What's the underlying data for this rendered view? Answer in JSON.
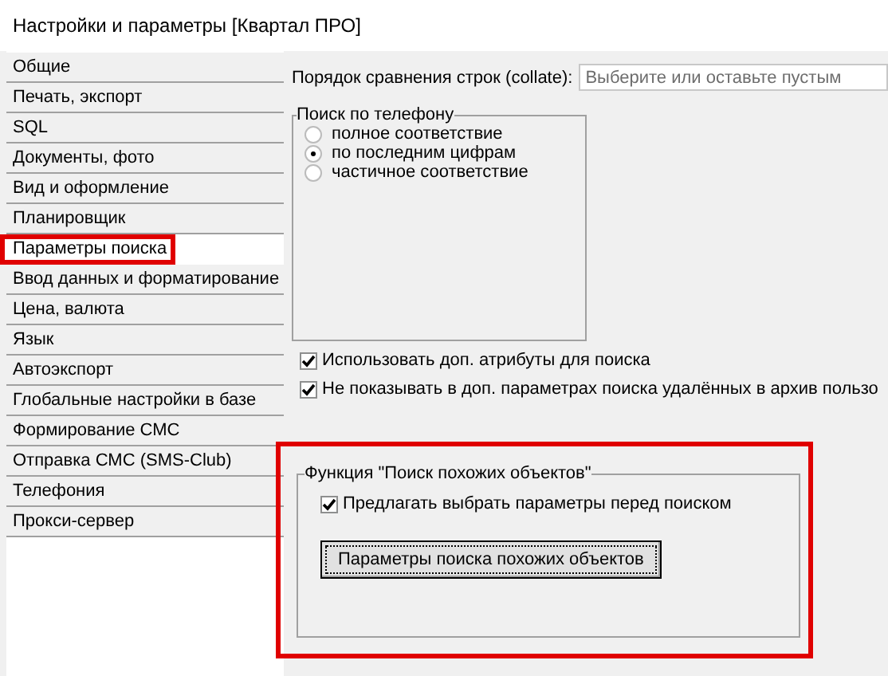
{
  "window": {
    "title": "Настройки и параметры [Квартал ПРО]"
  },
  "sidebar": {
    "items": [
      {
        "label": "Общие",
        "selected": false,
        "highlighted": false
      },
      {
        "label": "Печать, экспорт",
        "selected": false,
        "highlighted": false
      },
      {
        "label": "SQL",
        "selected": false,
        "highlighted": false
      },
      {
        "label": "Документы, фото",
        "selected": false,
        "highlighted": false
      },
      {
        "label": "Вид и оформление",
        "selected": false,
        "highlighted": false
      },
      {
        "label": "Планировщик",
        "selected": false,
        "highlighted": false
      },
      {
        "label": "Параметры поиска",
        "selected": true,
        "highlighted": true
      },
      {
        "label": "Ввод данных и форматирование",
        "selected": false,
        "highlighted": false
      },
      {
        "label": "Цена, валюта",
        "selected": false,
        "highlighted": false
      },
      {
        "label": "Язык",
        "selected": false,
        "highlighted": false
      },
      {
        "label": "Автоэкспорт",
        "selected": false,
        "highlighted": false
      },
      {
        "label": "Глобальные настройки в базе",
        "selected": false,
        "highlighted": false
      },
      {
        "label": "Формирование СМС",
        "selected": false,
        "highlighted": false
      },
      {
        "label": "Отправка СМС (SMS-Club)",
        "selected": false,
        "highlighted": false
      },
      {
        "label": "Телефония",
        "selected": false,
        "highlighted": false
      },
      {
        "label": "Прокси-сервер",
        "selected": false,
        "highlighted": false
      }
    ]
  },
  "collate": {
    "label": "Порядок сравнения строк (collate):",
    "placeholder": "Выберите или оставьте пустым"
  },
  "phone_search": {
    "title": "Поиск по телефону",
    "options": [
      {
        "label": "полное соответствие",
        "selected": false
      },
      {
        "label": "по последним цифрам",
        "selected": true
      },
      {
        "label": "частичное соответствие",
        "selected": false
      }
    ]
  },
  "checkboxes": [
    {
      "label": "Использовать доп. атрибуты для поиска",
      "checked": true
    },
    {
      "label": "Не показывать в доп. параметрах поиска удалённых в архив пользо",
      "checked": true
    }
  ],
  "similar_search": {
    "title": "Функция \"Поиск похожих объектов\"",
    "highlighted": true,
    "checkbox": {
      "label": "Предлагать выбрать параметры перед поиском",
      "checked": true
    },
    "button": "Параметры поиска похожих объектов"
  }
}
